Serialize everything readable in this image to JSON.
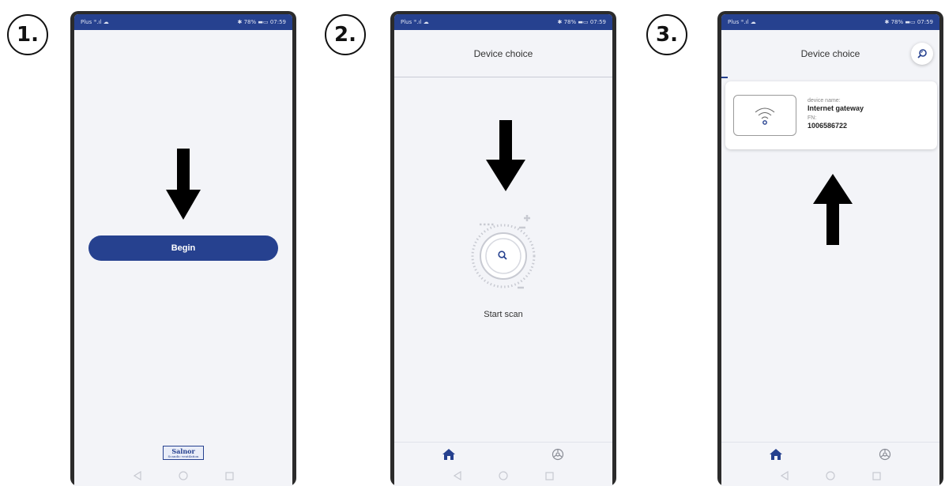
{
  "steps": [
    "1.",
    "2.",
    "3."
  ],
  "status_bar": {
    "left": "Plus ᴵᴵᴵ.ıl ☁",
    "right": "✱ 78% ▬▭ 07:59"
  },
  "screen1": {
    "begin_label": "Begin",
    "logo_text": "Salnor",
    "logo_sub": "Scandic ventilation"
  },
  "screen2": {
    "title": "Device choice",
    "scan_label": "Start scan"
  },
  "screen3": {
    "title": "Device choice",
    "device": {
      "name_label": "device name:",
      "name_value": "Internet gateway",
      "fn_label": "FN:",
      "fn_value": "1006586722"
    }
  },
  "icons": {
    "home": "home-icon",
    "settings": "settings-icon",
    "back": "back-triangle-icon",
    "home_nav": "circle-icon",
    "recent": "square-icon"
  },
  "colors": {
    "brand_blue": "#26418f",
    "screen_bg": "#f3f4f8",
    "arrow": "#000000"
  }
}
